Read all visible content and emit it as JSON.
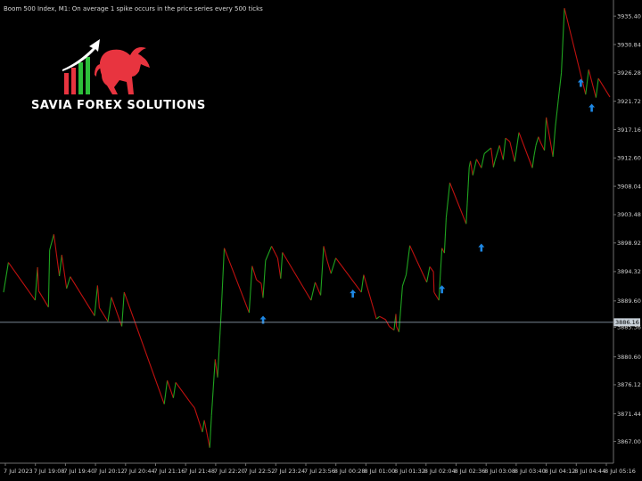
{
  "header": {
    "text": "Boom 500 Index, M1: On average 1 spike occurs in the price series every 500 ticks"
  },
  "logo": {
    "brand_text": "SAVIA FOREX SOLUTIONS",
    "colors": {
      "bull": "#e8343f",
      "bars": [
        "#e8343f",
        "#e8343f",
        "#2dbf3a",
        "#2dbf3a"
      ],
      "arrow": "#ffffff"
    }
  },
  "colors": {
    "background": "#000000",
    "axis": "#6e6e6e",
    "up_segment": "#1fa31f",
    "down_segment": "#c0110f",
    "signal_arrow": "#1e88e5",
    "current_price_line": "#8a98a6",
    "current_price_box": "#c7d0d8"
  },
  "chart_data": {
    "type": "line",
    "title": "Boom 500 Index, M1",
    "xlabel": "",
    "ylabel": "",
    "ylim": [
      3863.5,
      3938.0
    ],
    "grid": false,
    "y_ticks": [
      3867.0,
      3871.44,
      3876.12,
      3880.6,
      3885.36,
      3889.6,
      3894.32,
      3898.92,
      3903.48,
      3908.04,
      3912.6,
      3917.16,
      3921.72,
      3926.28,
      3930.84,
      3935.4
    ],
    "y_tick_labels": [
      "3867.00",
      "3871.44",
      "3876.12",
      "3880.60",
      "3885.36",
      "3889.60",
      "3894.32",
      "3898.92",
      "3903.48",
      "3908.04",
      "3912.60",
      "3917.16",
      "3921.72",
      "3926.28",
      "3930.84",
      "3935.40"
    ],
    "x_ticks": [
      "7 Jul 2023",
      "7 Jul 19:08",
      "7 Jul 19:40",
      "7 Jul 20:12",
      "7 Jul 20:44",
      "7 Jul 21:16",
      "7 Jul 21:48",
      "7 Jul 22:20",
      "7 Jul 22:52",
      "7 Jul 23:24",
      "7 Jul 23:56",
      "8 Jul 00:28",
      "8 Jul 01:00",
      "8 Jul 01:32",
      "8 Jul 02:04",
      "8 Jul 02:36",
      "8 Jul 03:08",
      "8 Jul 03:40",
      "8 Jul 04:12",
      "8 Jul 04:44",
      "8 Jul 05:16"
    ],
    "x_range": [
      0,
      100
    ],
    "current_price": 3886.16,
    "current_price_label": "3886.16",
    "series": [
      {
        "points": [
          [
            0,
            3891.0
          ],
          [
            0.8,
            3895.8
          ],
          [
            5.2,
            3889.7
          ],
          [
            5.6,
            3895.0
          ],
          [
            5.8,
            3891.2
          ],
          [
            7.4,
            3888.6
          ],
          [
            7.6,
            3897.8
          ],
          [
            8.3,
            3900.3
          ],
          [
            9.2,
            3893.6
          ],
          [
            9.6,
            3897.0
          ],
          [
            10.4,
            3891.6
          ],
          [
            11.0,
            3893.5
          ],
          [
            15.0,
            3887.2
          ],
          [
            15.5,
            3892.1
          ],
          [
            15.8,
            3888.5
          ],
          [
            17.2,
            3886.3
          ],
          [
            17.8,
            3890.2
          ],
          [
            19.5,
            3885.5
          ],
          [
            19.9,
            3891.0
          ],
          [
            26.5,
            3873.0
          ],
          [
            27.0,
            3876.8
          ],
          [
            28.0,
            3874.0
          ],
          [
            28.4,
            3876.5
          ],
          [
            31.0,
            3873.0
          ],
          [
            31.5,
            3872.4
          ],
          [
            32.8,
            3868.5
          ],
          [
            33.1,
            3870.4
          ],
          [
            33.6,
            3868.0
          ],
          [
            34.0,
            3866.0
          ],
          [
            34.3,
            3871.2
          ],
          [
            34.9,
            3880.2
          ],
          [
            35.3,
            3877.3
          ],
          [
            35.9,
            3887.8
          ],
          [
            36.4,
            3898.1
          ],
          [
            40.5,
            3887.7
          ],
          [
            41.0,
            3895.2
          ],
          [
            41.7,
            3893.0
          ],
          [
            42.5,
            3892.4
          ],
          [
            42.8,
            3890.1
          ],
          [
            43.2,
            3896.1
          ],
          [
            44.2,
            3898.4
          ],
          [
            45.2,
            3896.5
          ],
          [
            45.7,
            3893.2
          ],
          [
            46.0,
            3897.4
          ],
          [
            50.7,
            3889.7
          ],
          [
            51.4,
            3892.6
          ],
          [
            52.3,
            3890.5
          ],
          [
            52.8,
            3898.4
          ],
          [
            53.4,
            3896.0
          ],
          [
            54.0,
            3894.0
          ],
          [
            54.8,
            3896.5
          ],
          [
            59.0,
            3891.0
          ],
          [
            59.4,
            3893.8
          ],
          [
            61.5,
            3886.7
          ],
          [
            62.0,
            3887.1
          ],
          [
            63.0,
            3886.6
          ],
          [
            63.6,
            3885.5
          ],
          [
            64.4,
            3884.9
          ],
          [
            64.7,
            3887.5
          ],
          [
            64.8,
            3885.5
          ],
          [
            65.2,
            3884.6
          ],
          [
            65.8,
            3892.0
          ],
          [
            66.4,
            3893.8
          ],
          [
            67.0,
            3898.5
          ],
          [
            69.8,
            3892.6
          ],
          [
            70.3,
            3895.1
          ],
          [
            70.9,
            3894.3
          ],
          [
            71.0,
            3891.0
          ],
          [
            71.8,
            3889.7
          ],
          [
            72.3,
            3898.1
          ],
          [
            72.7,
            3897.3
          ],
          [
            73.0,
            3903.0
          ],
          [
            73.6,
            3908.6
          ],
          [
            76.3,
            3902.0
          ],
          [
            76.8,
            3911.1
          ],
          [
            77.0,
            3912.1
          ],
          [
            77.4,
            3909.8
          ],
          [
            78.0,
            3912.4
          ],
          [
            78.8,
            3911.0
          ],
          [
            79.3,
            3913.3
          ],
          [
            80.4,
            3914.2
          ],
          [
            80.8,
            3911.1
          ],
          [
            81.0,
            3912.0
          ],
          [
            81.8,
            3914.6
          ],
          [
            82.4,
            3912.3
          ],
          [
            82.8,
            3915.8
          ],
          [
            83.5,
            3915.2
          ],
          [
            84.0,
            3913.2
          ],
          [
            84.3,
            3912.0
          ],
          [
            85.0,
            3916.7
          ],
          [
            87.2,
            3911.0
          ],
          [
            87.5,
            3913.0
          ],
          [
            87.8,
            3914.6
          ],
          [
            88.2,
            3916.0
          ],
          [
            88.6,
            3915.0
          ],
          [
            89.2,
            3913.8
          ],
          [
            89.5,
            3919.1
          ],
          [
            90.6,
            3912.8
          ],
          [
            91.0,
            3917.6
          ],
          [
            91.5,
            3922.0
          ],
          [
            92.0,
            3926.3
          ],
          [
            92.5,
            3936.7
          ],
          [
            96.0,
            3922.8
          ],
          [
            96.5,
            3926.8
          ],
          [
            97.7,
            3922.3
          ],
          [
            98.1,
            3925.4
          ],
          [
            100,
            3922.4
          ]
        ]
      }
    ],
    "signal_arrows": [
      [
        42.8,
        3886.5
      ],
      [
        57.6,
        3890.7
      ],
      [
        72.3,
        3891.4
      ],
      [
        78.8,
        3898.1
      ],
      [
        95.2,
        3924.6
      ],
      [
        97.0,
        3920.6
      ]
    ]
  }
}
